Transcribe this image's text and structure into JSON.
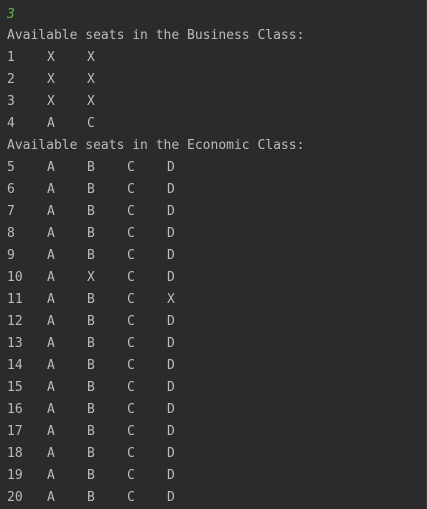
{
  "console": {
    "input_value": "3",
    "business_header": "Available seats in the Business Class:",
    "business_rows": [
      {
        "row": "1",
        "seats": [
          "X",
          "X"
        ]
      },
      {
        "row": "2",
        "seats": [
          "X",
          "X"
        ]
      },
      {
        "row": "3",
        "seats": [
          "X",
          "X"
        ]
      },
      {
        "row": "4",
        "seats": [
          "A",
          "C"
        ]
      }
    ],
    "economic_header": "Available seats in the Economic Class:",
    "economic_rows": [
      {
        "row": "5",
        "seats": [
          "A",
          "B",
          "C",
          "D"
        ]
      },
      {
        "row": "6",
        "seats": [
          "A",
          "B",
          "C",
          "D"
        ]
      },
      {
        "row": "7",
        "seats": [
          "A",
          "B",
          "C",
          "D"
        ]
      },
      {
        "row": "8",
        "seats": [
          "A",
          "B",
          "C",
          "D"
        ]
      },
      {
        "row": "9",
        "seats": [
          "A",
          "B",
          "C",
          "D"
        ]
      },
      {
        "row": "10",
        "seats": [
          "A",
          "X",
          "C",
          "D"
        ]
      },
      {
        "row": "11",
        "seats": [
          "A",
          "B",
          "C",
          "X"
        ]
      },
      {
        "row": "12",
        "seats": [
          "A",
          "B",
          "C",
          "D"
        ]
      },
      {
        "row": "13",
        "seats": [
          "A",
          "B",
          "C",
          "D"
        ]
      },
      {
        "row": "14",
        "seats": [
          "A",
          "B",
          "C",
          "D"
        ]
      },
      {
        "row": "15",
        "seats": [
          "A",
          "B",
          "C",
          "D"
        ]
      },
      {
        "row": "16",
        "seats": [
          "A",
          "B",
          "C",
          "D"
        ]
      },
      {
        "row": "17",
        "seats": [
          "A",
          "B",
          "C",
          "D"
        ]
      },
      {
        "row": "18",
        "seats": [
          "A",
          "B",
          "C",
          "D"
        ]
      },
      {
        "row": "19",
        "seats": [
          "A",
          "B",
          "C",
          "D"
        ]
      },
      {
        "row": "20",
        "seats": [
          "A",
          "B",
          "C",
          "D"
        ]
      }
    ]
  },
  "colors": {
    "background": "#2b2b2b",
    "text": "#bbbbbb",
    "user_input": "#62b543"
  }
}
